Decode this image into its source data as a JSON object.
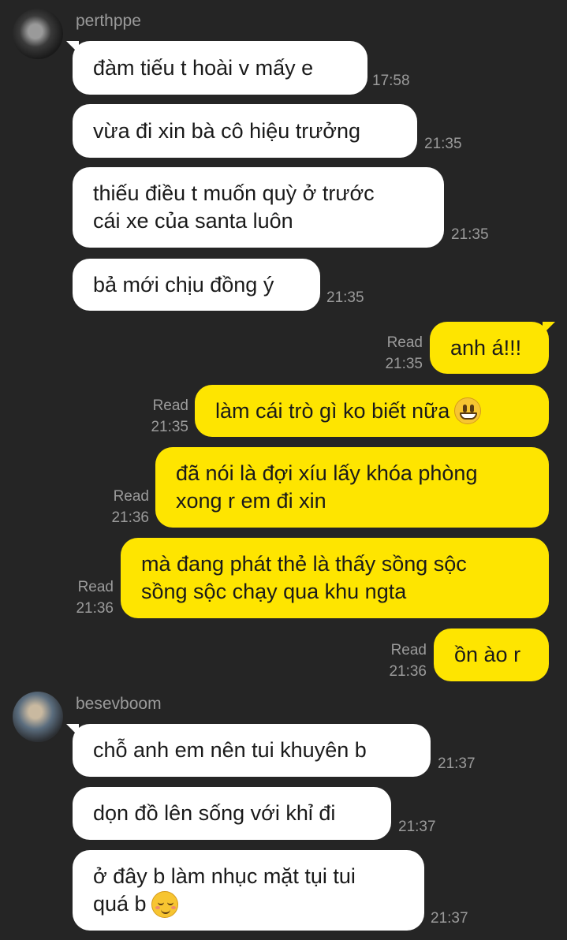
{
  "colors": {
    "background": "#252525",
    "incoming": "#ffffff",
    "outgoing": "#fee500",
    "meta": "#9b9b9b"
  },
  "senders": [
    {
      "name": "perthppe"
    },
    {
      "name": "besevboom"
    }
  ],
  "messages": [
    {
      "text": "đàm tiếu t hoài v mấy e",
      "time": "17:58"
    },
    {
      "text": "vừa đi xin bà cô hiệu trưởng",
      "time": "21:35"
    },
    {
      "text": "thiếu điều t muốn quỳ ở trước\ncái xe của santa luôn",
      "time": "21:35"
    },
    {
      "text": "bả mới chịu đồng ý",
      "time": "21:35"
    },
    {
      "text": "anh á!!!",
      "read": "Read",
      "time": "21:35"
    },
    {
      "text": "làm cái trò gì ko biết nữa",
      "emoji": "grinning-face",
      "read": "Read",
      "time": "21:35"
    },
    {
      "text": "đã nói là đợi xíu lấy khóa phòng\nxong r em đi xin",
      "read": "Read",
      "time": "21:36"
    },
    {
      "text": "mà đang phát thẻ là thấy sồng sộc\nsồng sộc chạy qua khu ngta",
      "read": "Read",
      "time": "21:36"
    },
    {
      "text": "ồn ào r",
      "read": "Read",
      "time": "21:36"
    },
    {
      "text": "chỗ anh em nên tui khuyên b",
      "time": "21:37"
    },
    {
      "text": "dọn đồ lên sống với khỉ đi",
      "time": "21:37"
    },
    {
      "text": "ở đây b làm nhục mặt tụi tui\nquá b",
      "emoji": "relieved-face",
      "time": "21:37"
    }
  ]
}
